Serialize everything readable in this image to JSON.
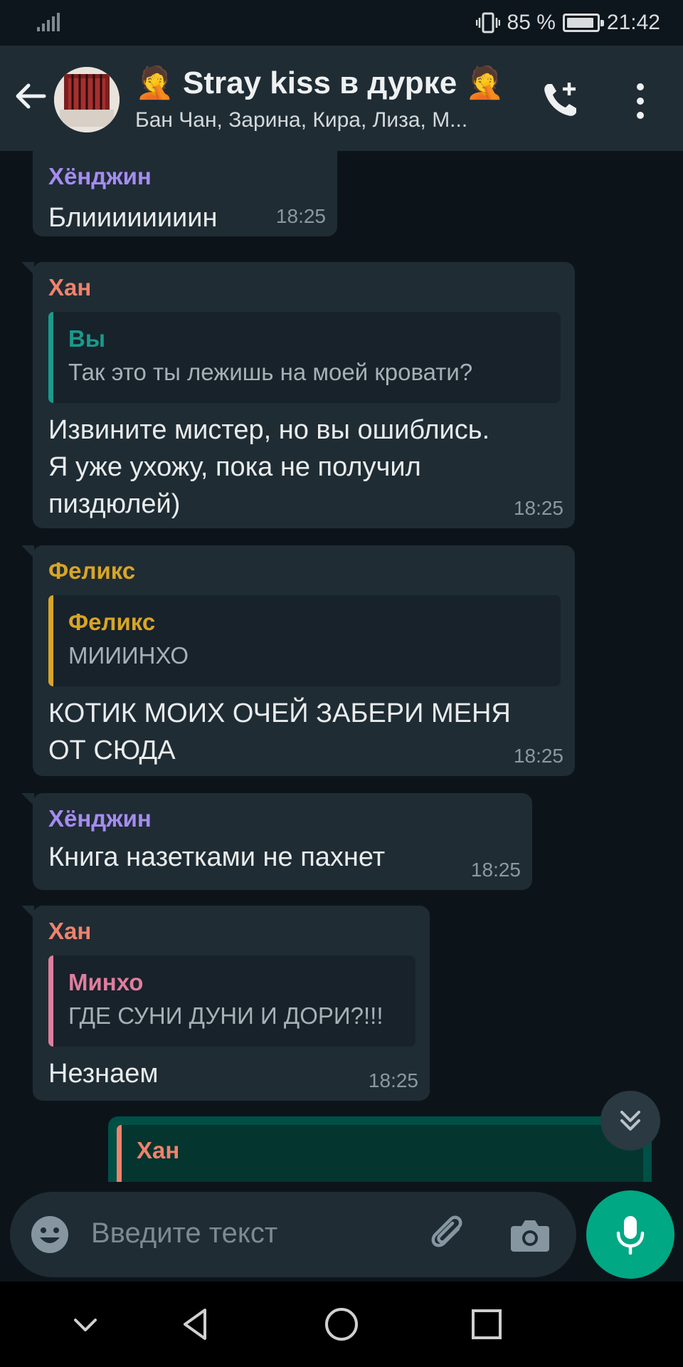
{
  "status_bar": {
    "battery_text": "85 %",
    "battery_level": 0.85,
    "time": "21:42"
  },
  "header": {
    "title": "🤦 Stray kiss в дурке 🤦",
    "subtitle": "Бан Чан, Зарина, Кира, Лиза, М..."
  },
  "messages": [
    {
      "sender": "Хёнджин",
      "sender_color": "#a58cf0",
      "text": "Блиииииииин",
      "time": "18:25"
    },
    {
      "sender": "Хан",
      "sender_color": "#f0826c",
      "quote": {
        "author": "Вы",
        "author_color": "#1a9a8b",
        "text": "Так это ты лежишь на моей кровати?"
      },
      "lines": [
        "Извините мистер, но вы ошиблись.",
        "Я уже ухожу, пока не получил",
        "пиздюлей)"
      ],
      "time": "18:25"
    },
    {
      "sender": "Феликс",
      "sender_color": "#d9a526",
      "quote": {
        "author": "Феликс",
        "author_color": "#d9a526",
        "text": "МИИИНХО"
      },
      "lines": [
        "КОТИК МОИХ ОЧЕЙ ЗАБЕРИ МЕНЯ",
        "ОТ СЮДА"
      ],
      "time": "18:25"
    },
    {
      "sender": "Хёнджин",
      "sender_color": "#a58cf0",
      "text": "Книга назетками не пахнет",
      "time": "18:25"
    },
    {
      "sender": "Хан",
      "sender_color": "#f0826c",
      "quote": {
        "author": "Минхо",
        "author_color": "#e07d9e",
        "text": "ГДЕ СУНИ ДУНИ И ДОРИ?!!!"
      },
      "text": "Незнаем",
      "time": "18:25"
    }
  ],
  "outgoing_partial": {
    "quote_author": "Хан",
    "quote_author_color": "#f0826c"
  },
  "input": {
    "placeholder": "Введите текст"
  },
  "colors": {
    "accent": "#00a884",
    "bubble_in": "#1f2c34",
    "bubble_out": "#005046",
    "background": "#0c141a"
  },
  "icons": [
    "back-arrow-icon",
    "add-call-icon",
    "more-vert-icon",
    "chevron-double-down-icon",
    "emoji-icon",
    "attach-icon",
    "camera-icon",
    "mic-icon",
    "nav-down-icon",
    "nav-back-icon",
    "nav-home-icon",
    "nav-recents-icon"
  ]
}
